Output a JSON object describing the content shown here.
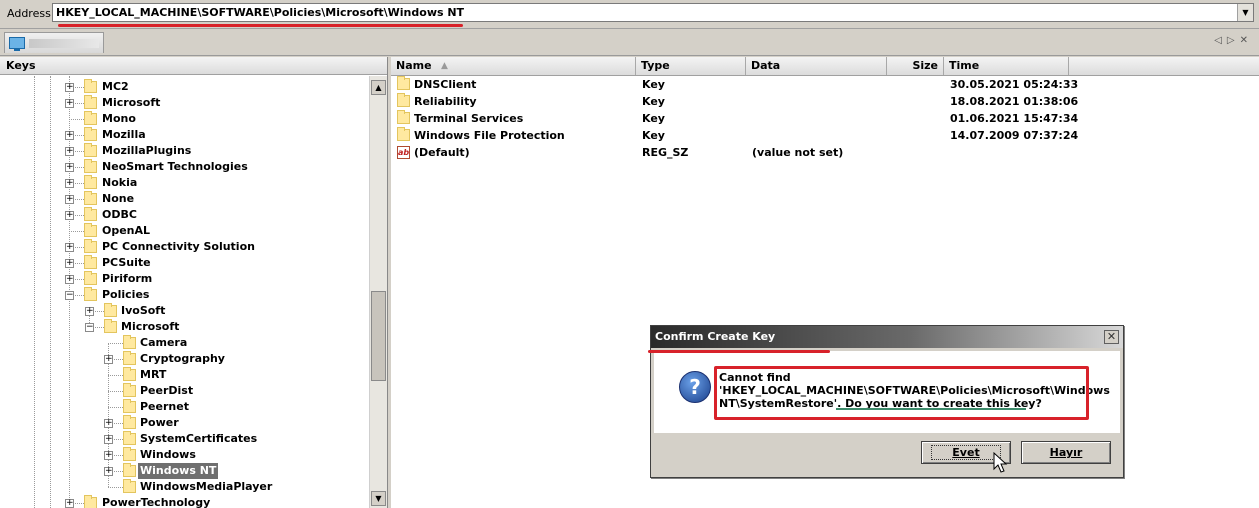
{
  "address": {
    "label": "Address",
    "value": "HKEY_LOCAL_MACHINE\\SOFTWARE\\Policies\\Microsoft\\Windows NT"
  },
  "keys_panel": {
    "title": "Keys"
  },
  "tree_items": [
    {
      "label": "MC2",
      "expander": "+"
    },
    {
      "label": "Microsoft",
      "expander": "+"
    },
    {
      "label": "Mono",
      "expander": ""
    },
    {
      "label": "Mozilla",
      "expander": "+"
    },
    {
      "label": "MozillaPlugins",
      "expander": "+"
    },
    {
      "label": "NeoSmart Technologies",
      "expander": "+"
    },
    {
      "label": "Nokia",
      "expander": "+"
    },
    {
      "label": "None",
      "expander": "+"
    },
    {
      "label": "ODBC",
      "expander": "+"
    },
    {
      "label": "OpenAL",
      "expander": ""
    },
    {
      "label": "PC Connectivity Solution",
      "expander": "+"
    },
    {
      "label": "PCSuite",
      "expander": "+"
    },
    {
      "label": "Piriform",
      "expander": "+"
    },
    {
      "label": "Policies",
      "expander": "−"
    },
    {
      "label": "IvoSoft",
      "expander": "+"
    },
    {
      "label": "Microsoft",
      "expander": "−"
    },
    {
      "label": "Camera",
      "expander": ""
    },
    {
      "label": "Cryptography",
      "expander": "+"
    },
    {
      "label": "MRT",
      "expander": ""
    },
    {
      "label": "PeerDist",
      "expander": ""
    },
    {
      "label": "Peernet",
      "expander": ""
    },
    {
      "label": "Power",
      "expander": "+"
    },
    {
      "label": "SystemCertificates",
      "expander": "+"
    },
    {
      "label": "Windows",
      "expander": "+"
    },
    {
      "label": "Windows NT",
      "expander": "+"
    },
    {
      "label": "WindowsMediaPlayer",
      "expander": ""
    },
    {
      "label": "PowerTechnology",
      "expander": "+"
    }
  ],
  "columns": {
    "name": "Name",
    "type": "Type",
    "data": "Data",
    "size": "Size",
    "time": "Time"
  },
  "values": [
    {
      "icon": "folder-icon",
      "name": "DNSClient",
      "type": "Key",
      "data": "",
      "size": "",
      "time": "30.05.2021 05:24:33"
    },
    {
      "icon": "folder-icon",
      "name": "Reliability",
      "type": "Key",
      "data": "",
      "size": "",
      "time": "18.08.2021 01:38:06"
    },
    {
      "icon": "folder-icon",
      "name": "Terminal Services",
      "type": "Key",
      "data": "",
      "size": "",
      "time": "01.06.2021 15:47:34"
    },
    {
      "icon": "folder-icon",
      "name": "Windows File Protection",
      "type": "Key",
      "data": "",
      "size": "",
      "time": "14.07.2009 07:37:24"
    },
    {
      "icon": "string-value-icon",
      "name": "(Default)",
      "type": "REG_SZ",
      "data": "(value not set)",
      "size": "",
      "time": ""
    }
  ],
  "dialog": {
    "title": "Confirm Create Key",
    "icon": "question-icon",
    "message_line1": "Cannot find",
    "message_line2": "'HKEY_LOCAL_MACHINE\\SOFTWARE\\Policies\\Microsoft\\Windows",
    "message_line3_a": "NT\\SystemRestore'.",
    "message_line3_b": "Do you want to create this key?",
    "yes_label": "Evet",
    "no_label": "Hayır",
    "close_glyph": "✕"
  },
  "icons": {
    "tab": "monitor-icon",
    "sort": "sort-asc-icon",
    "scroll_up": "▲",
    "scroll_down": "▼",
    "dropdown": "▼",
    "tab_prev": "◁",
    "tab_next": "▷",
    "tab_close": "✕"
  },
  "colors": {
    "annotation_red": "#d8222a",
    "annotation_green": "#3c8a6a",
    "selection": "#6f6f6f"
  }
}
